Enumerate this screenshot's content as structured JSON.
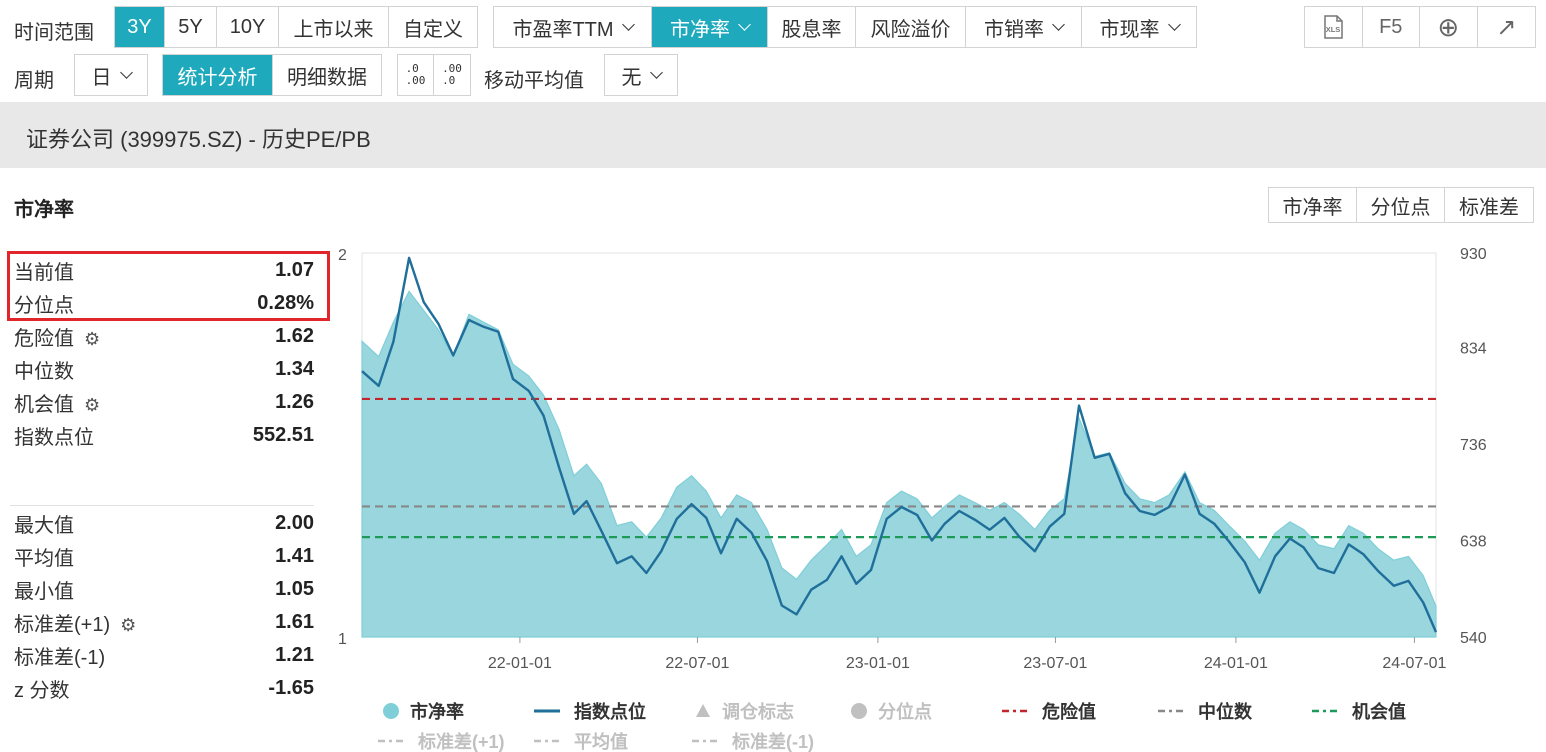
{
  "toolbar": {
    "time_range_label": "时间范围",
    "ranges": [
      "3Y",
      "5Y",
      "10Y",
      "上市以来",
      "自定义"
    ],
    "active_range": 0,
    "metrics": [
      "市盈率TTM",
      "市净率",
      "股息率",
      "风险溢价",
      "市销率",
      "市现率"
    ],
    "active_metric": 1,
    "tools": [
      "XLS",
      "F5",
      "⊕",
      "↗"
    ]
  },
  "toolbar2": {
    "period_label": "周期",
    "period_value": "日",
    "view_tabs": [
      "统计分析",
      "明细数据"
    ],
    "active_view": 0,
    "decimal_inc": ".0\n.00",
    "decimal_dec": ".00\n.0",
    "ma_label": "移动平均值",
    "ma_value": "无"
  },
  "title": "证券公司 (399975.SZ) - 历史PE/PB",
  "section_title": "市净率",
  "chart_tabs": [
    "市净率",
    "分位点",
    "标准差"
  ],
  "stats_top": [
    {
      "label": "当前值",
      "value": "1.07",
      "gear": false
    },
    {
      "label": "分位点",
      "value": "0.28%",
      "gear": false
    },
    {
      "label": "危险值",
      "value": "1.62",
      "gear": true
    },
    {
      "label": "中位数",
      "value": "1.34",
      "gear": false
    },
    {
      "label": "机会值",
      "value": "1.26",
      "gear": true
    },
    {
      "label": "指数点位",
      "value": "552.51",
      "gear": false
    }
  ],
  "stats_bottom": [
    {
      "label": "最大值",
      "value": "2.00",
      "gear": false
    },
    {
      "label": "平均值",
      "value": "1.41",
      "gear": false
    },
    {
      "label": "最小值",
      "value": "1.05",
      "gear": false
    },
    {
      "label": "标准差(+1)",
      "value": "1.61",
      "gear": true
    },
    {
      "label": "标准差(-1)",
      "value": "1.21",
      "gear": true
    },
    {
      "label": "z 分数",
      "value": "-1.65",
      "gear": false
    }
  ],
  "legend": [
    {
      "name": "市净率",
      "kind": "dot",
      "color": "#7fcfd8",
      "dim": false
    },
    {
      "name": "指数点位",
      "kind": "line",
      "color": "#1f6f9a",
      "dim": false
    },
    {
      "name": "调仓标志",
      "kind": "tri",
      "color": "#c0c0c0",
      "dim": true
    },
    {
      "name": "分位点",
      "kind": "dot",
      "color": "#c0c0c0",
      "dim": true
    },
    {
      "name": "危险值",
      "kind": "dash",
      "color": "#c0262b",
      "dim": false
    },
    {
      "name": "中位数",
      "kind": "dash",
      "color": "#888888",
      "dim": false
    },
    {
      "name": "机会值",
      "kind": "dash",
      "color": "#1e9a58",
      "dim": false
    },
    {
      "name": "标准差(+1)",
      "kind": "dash",
      "color": "#c0c0c0",
      "dim": true
    },
    {
      "name": "平均值",
      "kind": "dash",
      "color": "#c0c0c0",
      "dim": true
    },
    {
      "name": "标准差(-1)",
      "kind": "dash",
      "color": "#c0c0c0",
      "dim": true
    }
  ],
  "chart_data": {
    "type": "area",
    "x_ticks": [
      "22-01-01",
      "22-07-01",
      "23-01-01",
      "23-07-01",
      "24-01-01",
      "24-07-01"
    ],
    "x_range": [
      "2021-07-24",
      "2024-07-23"
    ],
    "y_left_ticks": [
      "2",
      "1"
    ],
    "y_left_range": [
      1,
      2
    ],
    "y_right_ticks": [
      "930",
      "834",
      "736",
      "638",
      "540"
    ],
    "y_right_range": [
      540,
      930
    ],
    "reference_lines": [
      {
        "name": "危险值",
        "value": 1.62,
        "color": "#c0262b"
      },
      {
        "name": "中位数",
        "value": 1.34,
        "color": "#888888"
      },
      {
        "name": "机会值",
        "value": 1.26,
        "color": "#1e9a58"
      }
    ],
    "series": [
      {
        "name": "市净率",
        "color": "#99d6de",
        "dates": [
          "2021-07-24",
          "2021-08-10",
          "2021-08-25",
          "2021-09-10",
          "2021-09-25",
          "2021-10-10",
          "2021-10-25",
          "2021-11-10",
          "2021-11-25",
          "2021-12-10",
          "2021-12-25",
          "2022-01-10",
          "2022-01-25",
          "2022-02-10",
          "2022-02-25",
          "2022-03-10",
          "2022-03-25",
          "2022-04-10",
          "2022-04-25",
          "2022-05-10",
          "2022-05-25",
          "2022-06-10",
          "2022-06-25",
          "2022-07-10",
          "2022-07-25",
          "2022-08-10",
          "2022-08-25",
          "2022-09-10",
          "2022-09-25",
          "2022-10-10",
          "2022-10-25",
          "2022-11-10",
          "2022-11-25",
          "2022-12-10",
          "2022-12-25",
          "2023-01-10",
          "2023-01-25",
          "2023-02-10",
          "2023-02-25",
          "2023-03-10",
          "2023-03-25",
          "2023-04-10",
          "2023-04-25",
          "2023-05-10",
          "2023-05-25",
          "2023-06-10",
          "2023-06-25",
          "2023-07-10",
          "2023-07-25",
          "2023-08-10",
          "2023-08-25",
          "2023-09-10",
          "2023-09-25",
          "2023-10-10",
          "2023-10-25",
          "2023-11-10",
          "2023-11-25",
          "2023-12-10",
          "2023-12-25",
          "2024-01-10",
          "2024-01-25",
          "2024-02-10",
          "2024-02-25",
          "2024-03-10",
          "2024-03-25",
          "2024-04-10",
          "2024-04-25",
          "2024-05-10",
          "2024-05-25",
          "2024-06-10",
          "2024-06-25",
          "2024-07-10",
          "2024-07-23"
        ],
        "values": [
          1.77,
          1.73,
          1.82,
          1.9,
          1.85,
          1.8,
          1.73,
          1.84,
          1.82,
          1.8,
          1.71,
          1.68,
          1.63,
          1.54,
          1.42,
          1.45,
          1.4,
          1.29,
          1.3,
          1.26,
          1.31,
          1.39,
          1.42,
          1.38,
          1.31,
          1.37,
          1.35,
          1.28,
          1.18,
          1.15,
          1.2,
          1.24,
          1.28,
          1.21,
          1.24,
          1.35,
          1.38,
          1.36,
          1.31,
          1.34,
          1.37,
          1.35,
          1.33,
          1.35,
          1.32,
          1.28,
          1.33,
          1.36,
          1.57,
          1.47,
          1.48,
          1.4,
          1.36,
          1.35,
          1.37,
          1.43,
          1.35,
          1.33,
          1.29,
          1.25,
          1.2,
          1.27,
          1.3,
          1.28,
          1.24,
          1.23,
          1.29,
          1.27,
          1.23,
          1.2,
          1.21,
          1.16,
          1.08
        ]
      },
      {
        "name": "指数点位",
        "color": "#1f6f9a",
        "dates": [
          "2021-07-24",
          "2021-08-10",
          "2021-08-25",
          "2021-09-10",
          "2021-09-25",
          "2021-10-10",
          "2021-10-25",
          "2021-11-10",
          "2021-11-25",
          "2021-12-10",
          "2021-12-25",
          "2022-01-10",
          "2022-01-25",
          "2022-02-10",
          "2022-02-25",
          "2022-03-10",
          "2022-03-25",
          "2022-04-10",
          "2022-04-25",
          "2022-05-10",
          "2022-05-25",
          "2022-06-10",
          "2022-06-25",
          "2022-07-10",
          "2022-07-25",
          "2022-08-10",
          "2022-08-25",
          "2022-09-10",
          "2022-09-25",
          "2022-10-10",
          "2022-10-25",
          "2022-11-10",
          "2022-11-25",
          "2022-12-10",
          "2022-12-25",
          "2023-01-10",
          "2023-01-25",
          "2023-02-10",
          "2023-02-25",
          "2023-03-10",
          "2023-03-25",
          "2023-04-10",
          "2023-04-25",
          "2023-05-10",
          "2023-05-25",
          "2023-06-10",
          "2023-06-25",
          "2023-07-10",
          "2023-07-25",
          "2023-08-10",
          "2023-08-25",
          "2023-09-10",
          "2023-09-25",
          "2023-10-10",
          "2023-10-25",
          "2023-11-10",
          "2023-11-25",
          "2023-12-10",
          "2023-12-25",
          "2024-01-10",
          "2024-01-25",
          "2024-02-10",
          "2024-02-25",
          "2024-03-10",
          "2024-03-25",
          "2024-04-10",
          "2024-04-25",
          "2024-05-10",
          "2024-05-25",
          "2024-06-10",
          "2024-06-25",
          "2024-07-10",
          "2024-07-23"
        ],
        "values": [
          810,
          795,
          840,
          925,
          880,
          858,
          826,
          862,
          855,
          850,
          802,
          790,
          765,
          712,
          665,
          678,
          648,
          615,
          622,
          605,
          627,
          660,
          675,
          661,
          625,
          660,
          646,
          617,
          572,
          563,
          588,
          598,
          622,
          594,
          608,
          660,
          672,
          664,
          638,
          655,
          668,
          659,
          649,
          661,
          642,
          627,
          652,
          665,
          775,
          722,
          726,
          686,
          668,
          664,
          672,
          705,
          665,
          655,
          637,
          616,
          585,
          622,
          640,
          631,
          610,
          605,
          634,
          624,
          607,
          592,
          597,
          575,
          545
        ]
      }
    ]
  }
}
